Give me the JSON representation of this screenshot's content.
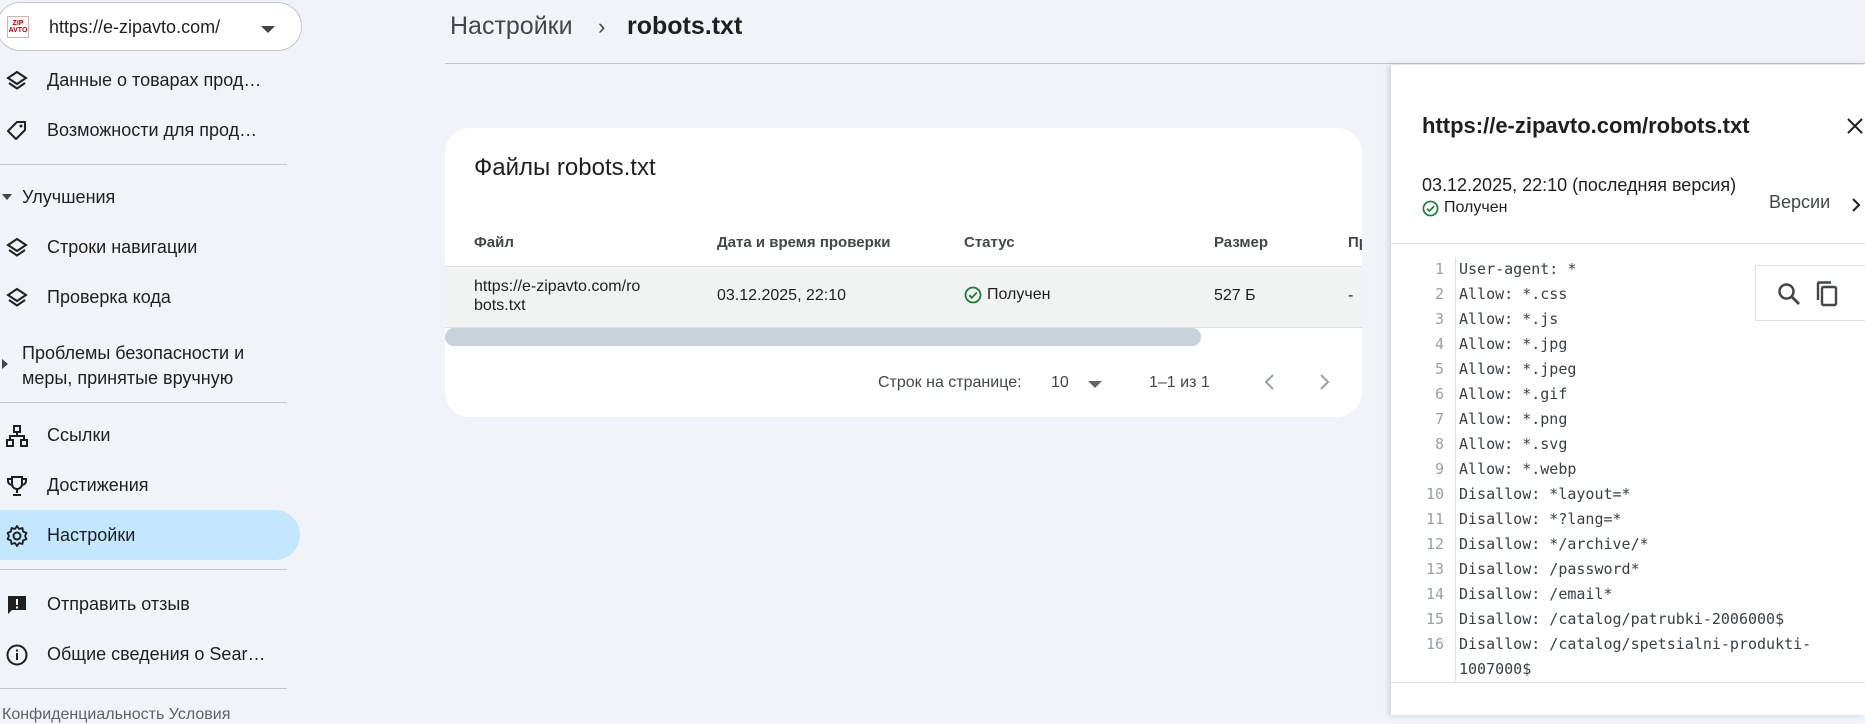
{
  "sidebar": {
    "property_url": "https://e-zipavto.com/",
    "favicon_text": "ZIP AVTO",
    "items_top": [
      {
        "label": "Данные о товарах прод…",
        "icon": "layers-icon"
      },
      {
        "label": "Возможности для прод…",
        "icon": "tag-icon"
      }
    ],
    "section_improvements": "Улучшения",
    "items_improvements": [
      {
        "label": "Строки навигации",
        "icon": "layers-icon"
      },
      {
        "label": "Проверка кода",
        "icon": "layers-icon"
      }
    ],
    "section_security_line1": "Проблемы безопасности и",
    "section_security_line2": "меры, принятые вручную",
    "items_bottom": [
      {
        "label": "Ссылки",
        "icon": "sitemap-icon"
      },
      {
        "label": "Достижения",
        "icon": "trophy-icon"
      },
      {
        "label": "Настройки",
        "icon": "gear-icon"
      }
    ],
    "items_footer": [
      {
        "label": "Отправить отзыв",
        "icon": "feedback-icon"
      },
      {
        "label": "Общие сведения о Sear…",
        "icon": "info-icon"
      }
    ],
    "footer_links": "Конфиденциальность     Условия"
  },
  "breadcrumb": {
    "parent": "Настройки",
    "separator": "›",
    "current": "robots.txt"
  },
  "card": {
    "title": "Файлы robots.txt",
    "columns": [
      "Файл",
      "Дата и время проверки",
      "Статус",
      "Размер",
      "Пр"
    ],
    "rows": [
      {
        "file": "https://e-zipavto.com/robots.txt",
        "checked": "03.12.2025, 22:10",
        "status": "Получен",
        "size": "527 Б",
        "extra": "-"
      }
    ],
    "pager": {
      "rows_label": "Строк на странице:",
      "rows_value": "10",
      "range": "1–1 из 1"
    }
  },
  "panel": {
    "title": "https://e-zipavto.com/robots.txt",
    "date": "03.12.2025, 22:10 (последняя версия)",
    "status": "Получен",
    "versions": "Версии",
    "code_lines": [
      {
        "n": "1",
        "text": "User-agent: *"
      },
      {
        "n": "2",
        "text": "Allow: *.css"
      },
      {
        "n": "3",
        "text": "Allow: *.js"
      },
      {
        "n": "4",
        "text": "Allow: *.jpg"
      },
      {
        "n": "5",
        "text": "Allow: *.jpeg"
      },
      {
        "n": "6",
        "text": "Allow: *.gif"
      },
      {
        "n": "7",
        "text": "Allow: *.png"
      },
      {
        "n": "8",
        "text": "Allow: *.svg"
      },
      {
        "n": "9",
        "text": "Allow: *.webp"
      },
      {
        "n": "10",
        "text": "Disallow: *layout=*"
      },
      {
        "n": "11",
        "text": "Disallow: *?lang=*"
      },
      {
        "n": "12",
        "text": "Disallow: */archive/*"
      },
      {
        "n": "13",
        "text": "Disallow: /password*"
      },
      {
        "n": "14",
        "text": "Disallow: /email*"
      },
      {
        "n": "15",
        "text": "Disallow: /catalog/patrubki-2006000$"
      },
      {
        "n": "16",
        "text": "Disallow: /catalog/spetsialni-produkti-"
      },
      {
        "n": "",
        "text": "1007000$"
      }
    ]
  },
  "colors": {
    "active_nav": "#c2e7ff",
    "success": "#188038",
    "background": "#f0f4f9"
  }
}
